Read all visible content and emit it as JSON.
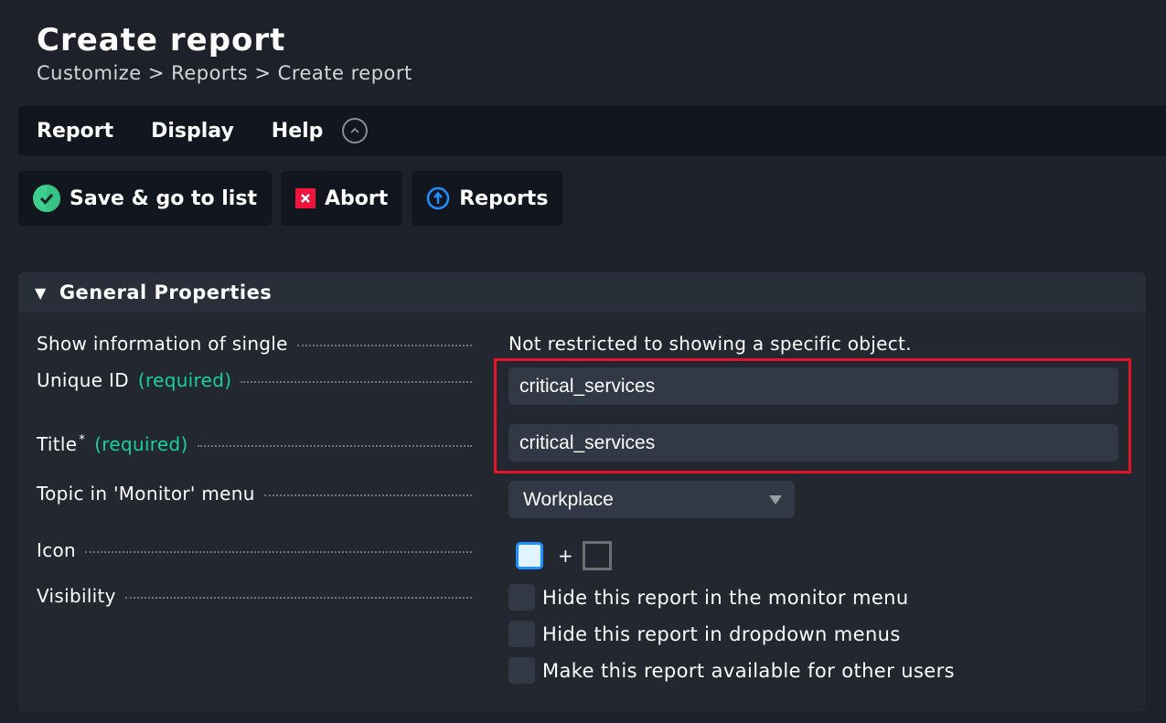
{
  "header": {
    "title": "Create report",
    "breadcrumb": "Customize > Reports > Create report"
  },
  "menubar": {
    "items": [
      "Report",
      "Display",
      "Help"
    ],
    "collapse_icon": "chevron-up-circle-icon"
  },
  "toolbar": {
    "save_label": "Save & go to list",
    "abort_label": "Abort",
    "reports_label": "Reports",
    "colors": {
      "save": "#3ecf8e",
      "abort": "#f0133e",
      "reports": "#1e90ff"
    }
  },
  "panel": {
    "title": "General Properties",
    "fields": {
      "single_info": {
        "label": "Show information of single",
        "value": "Not restricted to showing a specific object."
      },
      "unique_id": {
        "label": "Unique ID",
        "required": "(required)",
        "value": "critical_services"
      },
      "title": {
        "label": "Title",
        "asterisk": "*",
        "required": "(required)",
        "value": "critical_services"
      },
      "topic": {
        "label": "Topic in 'Monitor' menu",
        "value": "Workplace"
      },
      "icon": {
        "label": "Icon",
        "plus": "+"
      },
      "visibility": {
        "label": "Visibility",
        "options": [
          {
            "label": "Hide this report in the monitor menu",
            "checked": false
          },
          {
            "label": "Hide this report in dropdown menus",
            "checked": false
          },
          {
            "label": "Make this report available for other users",
            "checked": false
          }
        ]
      }
    },
    "highlight_color": "#e3142a",
    "required_color": "#15d1a0"
  }
}
